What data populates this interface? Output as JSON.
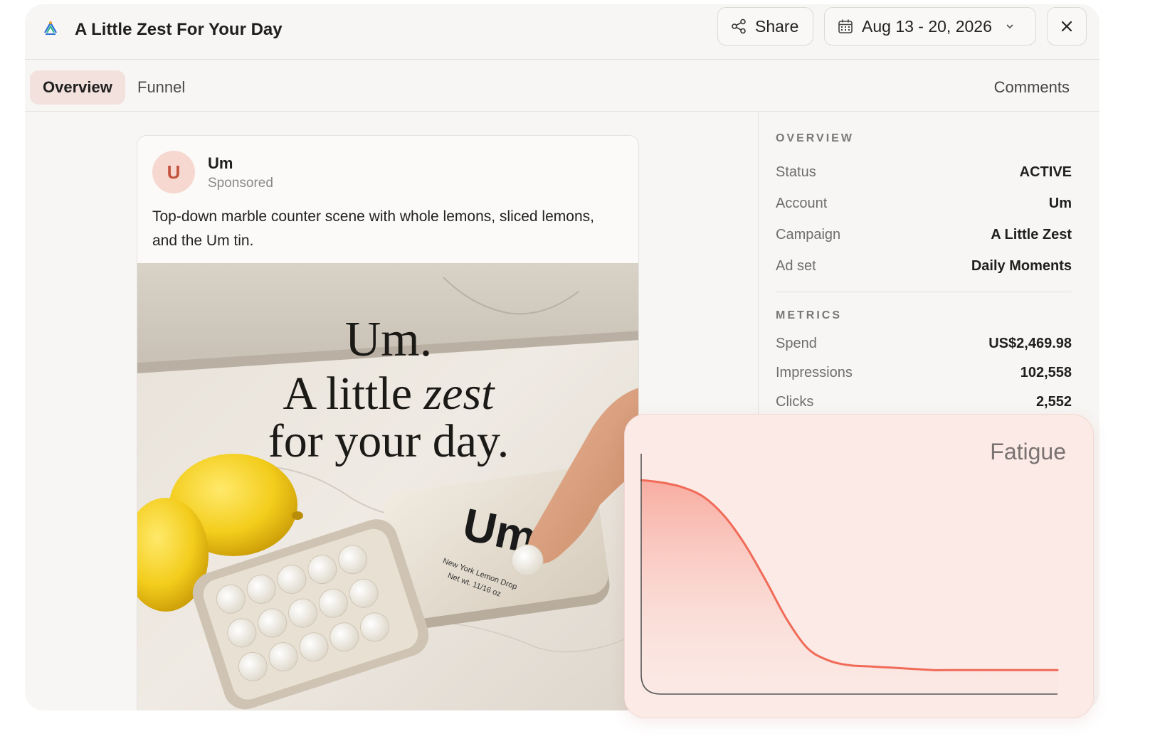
{
  "header": {
    "title": "A Little Zest For Your Day",
    "share_label": "Share",
    "date_range": "Aug 13 - 20, 2026"
  },
  "tabs": {
    "overview": "Overview",
    "funnel": "Funnel",
    "comments": "Comments"
  },
  "ad": {
    "avatar_letter": "U",
    "advertiser": "Um",
    "sponsored_label": "Sponsored",
    "caption": "Top-down marble counter scene with whole lemons, sliced lemons, and the Um tin.",
    "image": {
      "headline_line1": "Um.",
      "headline_line2_prefix": "A little ",
      "headline_line2_emph": "zest",
      "headline_line3": "for your day.",
      "tin_brand": "Um",
      "tin_sub1": "New York Lemon Drop",
      "tin_sub2": "Net wt. 11/16 oz"
    }
  },
  "overview": {
    "section_label": "OVERVIEW",
    "rows": [
      {
        "label": "Status",
        "value": "ACTIVE"
      },
      {
        "label": "Account",
        "value": "Um"
      },
      {
        "label": "Campaign",
        "value": "A Little Zest"
      },
      {
        "label": "Ad set",
        "value": "Daily Moments"
      }
    ]
  },
  "metrics": {
    "section_label": "METRICS",
    "rows": [
      {
        "label": "Spend",
        "value": "US$2,469.98"
      },
      {
        "label": "Impressions",
        "value": "102,558"
      },
      {
        "label": "Clicks",
        "value": "2,552"
      }
    ]
  },
  "fatigue": {
    "title": "Fatigue"
  },
  "chart_data": {
    "type": "area",
    "title": "Fatigue",
    "xlabel": "",
    "ylabel": "",
    "x": [
      0,
      0.05,
      0.1,
      0.15,
      0.2,
      0.25,
      0.3,
      0.35,
      0.4,
      0.45,
      0.5,
      0.55,
      0.6,
      0.65,
      0.7,
      0.75,
      0.8,
      0.85,
      0.9,
      0.95,
      1.0
    ],
    "y": [
      0.89,
      0.88,
      0.86,
      0.82,
      0.74,
      0.62,
      0.47,
      0.31,
      0.19,
      0.14,
      0.12,
      0.115,
      0.11,
      0.105,
      0.1,
      0.1,
      0.1,
      0.1,
      0.1,
      0.1,
      0.1
    ],
    "xlim": [
      0,
      1
    ],
    "ylim": [
      0,
      1
    ],
    "grid": false,
    "colors": {
      "line": "#f06b58",
      "fill_top": "#f8a99d",
      "fill_bottom": "#fbe4df",
      "axis": "#555555"
    }
  }
}
